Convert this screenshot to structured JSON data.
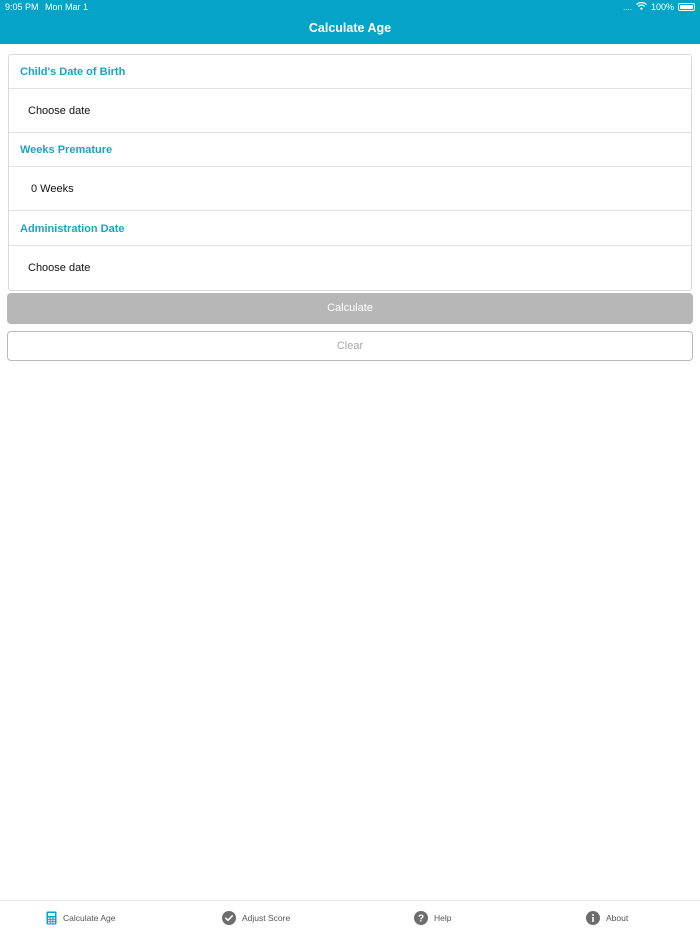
{
  "status_bar": {
    "time": "9:05 PM",
    "date": "Mon Mar 1",
    "signal": "....",
    "battery_text": "100%"
  },
  "nav": {
    "title": "Calculate Age"
  },
  "form": {
    "dob_header": "Child's Date of Birth",
    "dob_value": "Choose date",
    "weeks_header": "Weeks Premature",
    "weeks_value": "0 Weeks",
    "admin_header": "Administration Date",
    "admin_value": "Choose date"
  },
  "buttons": {
    "calculate": "Calculate",
    "clear": "Clear"
  },
  "tabs": [
    {
      "label": "Calculate Age",
      "icon": "calculator-icon",
      "active": true
    },
    {
      "label": "Adjust Score",
      "icon": "checkmark-circle-icon",
      "active": false
    },
    {
      "label": "Help",
      "icon": "question-circle-icon",
      "active": false
    },
    {
      "label": "About",
      "icon": "info-circle-icon",
      "active": false
    }
  ],
  "colors": {
    "accent": "#05a3c7",
    "section_header": "#1ba3c2",
    "disabled_button": "#b7b7b7"
  }
}
